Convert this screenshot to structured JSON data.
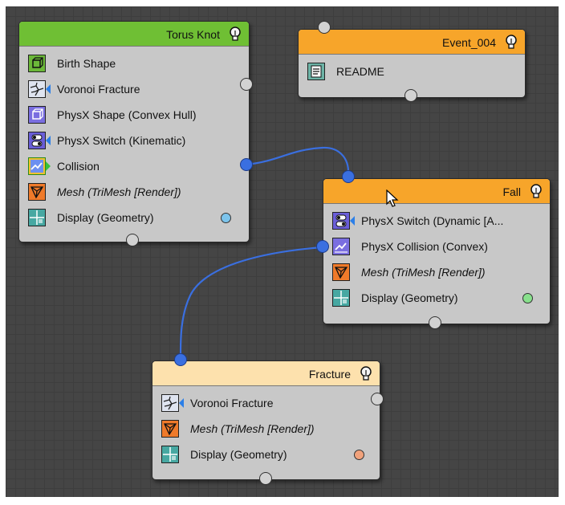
{
  "colors": {
    "header_torus": "#6fbf34",
    "header_event": "#f7a52a",
    "header_fall": "#f7a52a",
    "header_fracture": "#fde1ad",
    "wire": "#3a6fe0"
  },
  "nodes": {
    "torus_knot": {
      "title": "Torus Knot",
      "items": [
        {
          "label": "Birth Shape",
          "icon": "birth-shape-icon"
        },
        {
          "label": "Voronoi Fracture",
          "icon": "voronoi-fracture-icon"
        },
        {
          "label": "PhysX Shape (Convex Hull)",
          "icon": "physx-shape-icon"
        },
        {
          "label": "PhysX Switch (Kinematic)",
          "icon": "physx-switch-icon"
        },
        {
          "label": "Collision",
          "icon": "collision-icon"
        },
        {
          "label": "Mesh (TriMesh [Render])",
          "icon": "mesh-icon"
        },
        {
          "label": "Display (Geometry)",
          "icon": "display-icon",
          "status_color": "#7cc4ec"
        }
      ]
    },
    "event_004": {
      "title": "Event_004",
      "items": [
        {
          "label": "README",
          "icon": "readme-icon"
        }
      ]
    },
    "fall": {
      "title": "Fall",
      "items": [
        {
          "label": "PhysX Switch (Dynamic [A...",
          "icon": "physx-switch-icon"
        },
        {
          "label": "PhysX Collision (Convex)",
          "icon": "physx-collision-icon"
        },
        {
          "label": "Mesh (TriMesh [Render])",
          "icon": "mesh-icon"
        },
        {
          "label": "Display (Geometry)",
          "icon": "display-icon",
          "status_color": "#88e08c"
        }
      ]
    },
    "fracture": {
      "title": "Fracture",
      "items": [
        {
          "label": "Voronoi Fracture",
          "icon": "voronoi-fracture-icon"
        },
        {
          "label": "Mesh (TriMesh [Render])",
          "icon": "mesh-icon"
        },
        {
          "label": "Display (Geometry)",
          "icon": "display-icon",
          "status_color": "#f1a27c"
        }
      ]
    }
  }
}
